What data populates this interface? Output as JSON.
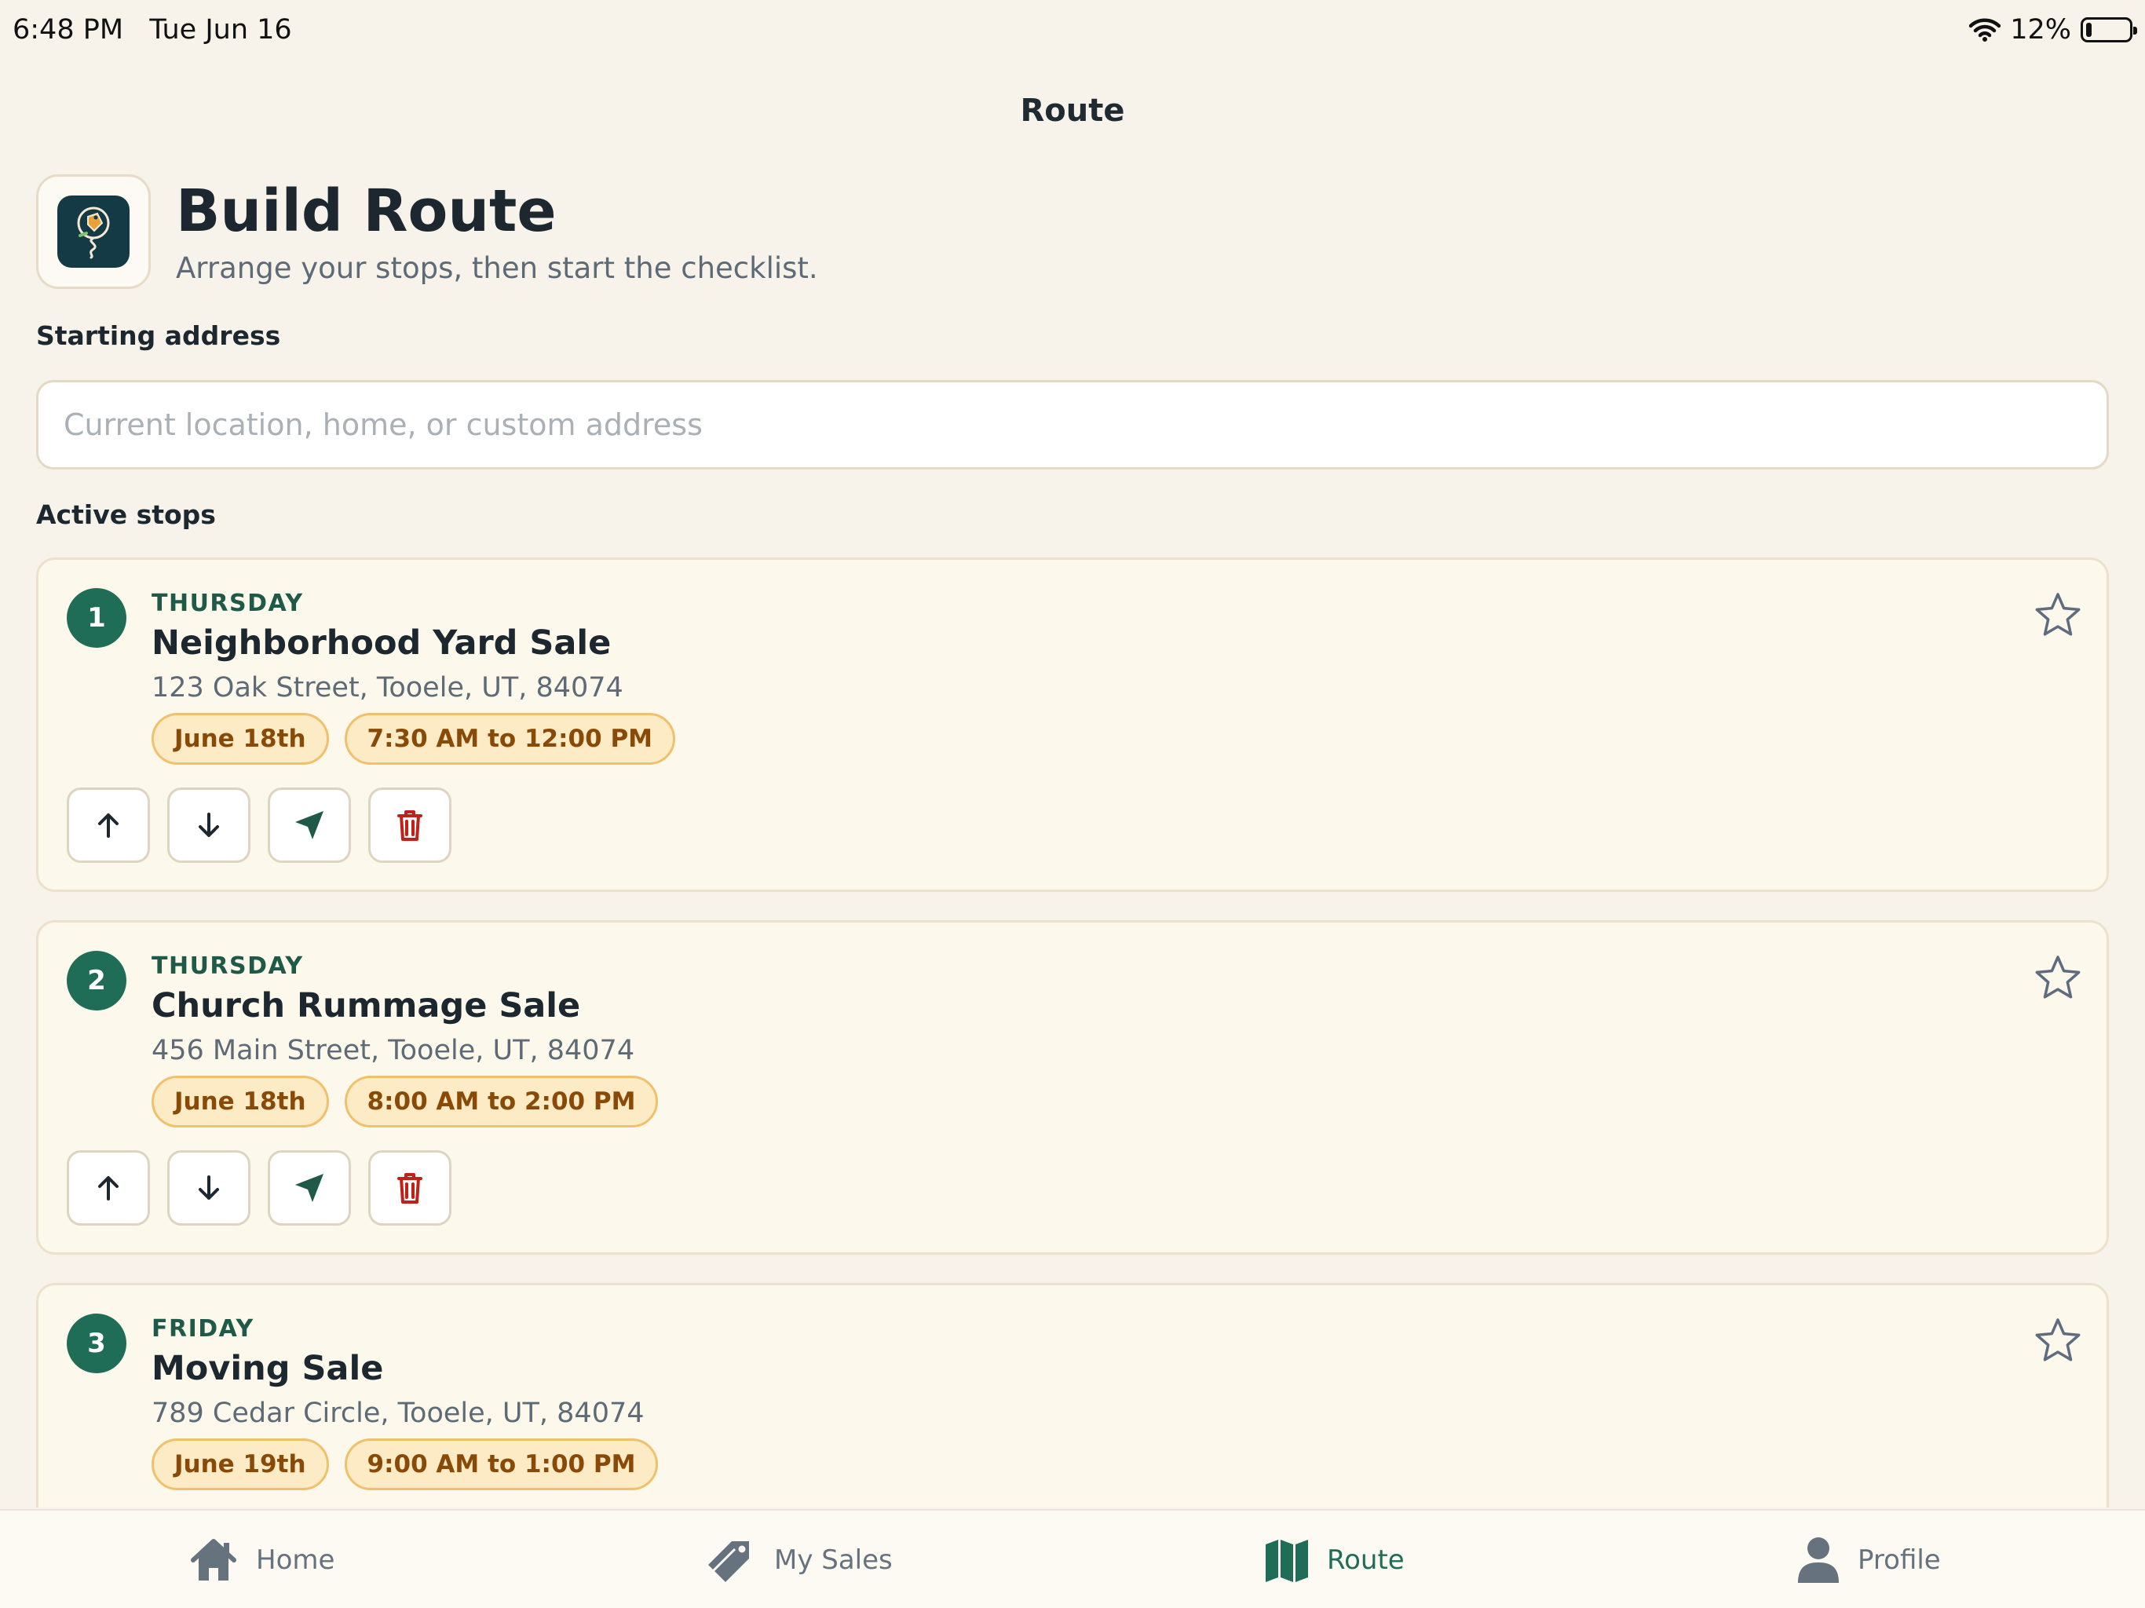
{
  "status": {
    "time": "6:48 PM",
    "date": "Tue Jun 16",
    "battery": "12%"
  },
  "nav": {
    "title": "Route"
  },
  "header": {
    "title": "Build Route",
    "subtitle": "Arrange your stops, then start the checklist."
  },
  "start": {
    "label": "Starting address",
    "value": "",
    "placeholder": "Current location, home, or custom address"
  },
  "stops_label": "Active stops",
  "stops": [
    {
      "num": "1",
      "day": "THURSDAY",
      "name": "Neighborhood Yard Sale",
      "address": "123 Oak Street, Tooele, UT, 84074",
      "date": "June 18th",
      "time": "7:30 AM to 12:00 PM"
    },
    {
      "num": "2",
      "day": "THURSDAY",
      "name": "Church Rummage Sale",
      "address": "456 Main Street, Tooele, UT, 84074",
      "date": "June 18th",
      "time": "8:00 AM to 2:00 PM"
    },
    {
      "num": "3",
      "day": "FRIDAY",
      "name": "Moving Sale",
      "address": "789 Cedar Circle, Tooele, UT, 84074",
      "date": "June 19th",
      "time": "9:00 AM to 1:00 PM"
    }
  ],
  "tabs": [
    {
      "label": "Home",
      "icon": "house-icon",
      "active": false
    },
    {
      "label": "My Sales",
      "icon": "tag-icon",
      "active": false
    },
    {
      "label": "Route",
      "icon": "map-icon",
      "active": true
    },
    {
      "label": "Profile",
      "icon": "person-icon",
      "active": false
    }
  ],
  "colors": {
    "background": "#f7f3ea",
    "accent": "#1f6d57",
    "chip_bg": "#fdebc5",
    "chip_text": "#8a4a07",
    "delete": "#c0221a"
  }
}
